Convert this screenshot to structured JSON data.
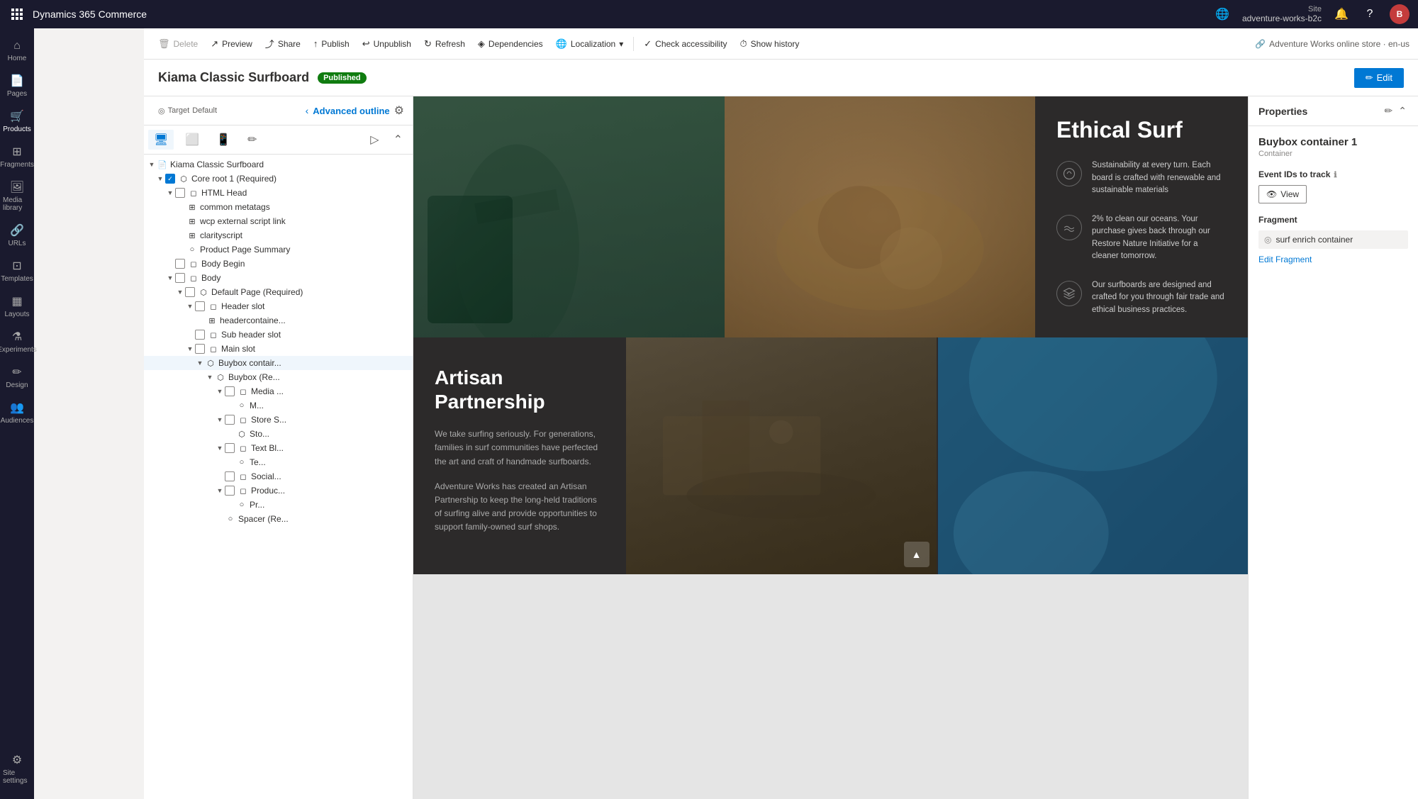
{
  "appBar": {
    "title": "Dynamics 365 Commerce",
    "site_label": "Site",
    "site_name": "adventure-works-b2c",
    "store_link": "Adventure Works online store · en-us"
  },
  "toolbar": {
    "delete_label": "Delete",
    "preview_label": "Preview",
    "share_label": "Share",
    "publish_label": "Publish",
    "unpublish_label": "Unpublish",
    "refresh_label": "Refresh",
    "dependencies_label": "Dependencies",
    "localization_label": "Localization",
    "check_accessibility_label": "Check accessibility",
    "show_history_label": "Show history"
  },
  "pageHeader": {
    "title": "Kiama Classic Surfboard",
    "status": "Published",
    "edit_label": "Edit",
    "target_label": "Target",
    "target_value": "Default"
  },
  "outline": {
    "title": "Advanced outline",
    "back_label": "‹",
    "tree": [
      {
        "id": 1,
        "label": "Kiama Classic Surfboard",
        "level": 0,
        "type": "page",
        "expanded": true,
        "hasChevron": true
      },
      {
        "id": 2,
        "label": "Core root 1 (Required)",
        "level": 1,
        "type": "container",
        "expanded": true,
        "hasChevron": true,
        "hasCheckbox": true
      },
      {
        "id": 3,
        "label": "HTML Head",
        "level": 2,
        "type": "module",
        "expanded": true,
        "hasChevron": true,
        "hasCheckbox": true
      },
      {
        "id": 4,
        "label": "common metatags",
        "level": 3,
        "type": "module",
        "hasCheckbox": false
      },
      {
        "id": 5,
        "label": "wcp external script link",
        "level": 3,
        "type": "module",
        "hasCheckbox": false
      },
      {
        "id": 6,
        "label": "clarityscript",
        "level": 3,
        "type": "module",
        "hasCheckbox": false
      },
      {
        "id": 7,
        "label": "Product Page Summary",
        "level": 3,
        "type": "circle",
        "hasCheckbox": false
      },
      {
        "id": 8,
        "label": "Body Begin",
        "level": 2,
        "type": "module",
        "hasCheckbox": true
      },
      {
        "id": 9,
        "label": "Body",
        "level": 2,
        "type": "module",
        "expanded": true,
        "hasChevron": true,
        "hasCheckbox": true
      },
      {
        "id": 10,
        "label": "Default Page (Required)",
        "level": 3,
        "type": "container",
        "expanded": true,
        "hasChevron": true,
        "hasCheckbox": true
      },
      {
        "id": 11,
        "label": "Header slot",
        "level": 4,
        "type": "module",
        "expanded": true,
        "hasChevron": true,
        "hasCheckbox": true
      },
      {
        "id": 12,
        "label": "headercontaine...",
        "level": 5,
        "type": "module",
        "hasCheckbox": false
      },
      {
        "id": 13,
        "label": "Sub header slot",
        "level": 4,
        "type": "module",
        "hasCheckbox": true
      },
      {
        "id": 14,
        "label": "Main slot",
        "level": 4,
        "type": "module",
        "expanded": true,
        "hasChevron": true,
        "hasCheckbox": true
      },
      {
        "id": 15,
        "label": "Buybox contair...",
        "level": 5,
        "type": "container",
        "expanded": true,
        "hasChevron": true,
        "selected": true
      },
      {
        "id": 16,
        "label": "Buybox (Re...",
        "level": 6,
        "type": "container",
        "expanded": true,
        "hasChevron": true
      },
      {
        "id": 17,
        "label": "Media ...",
        "level": 7,
        "type": "module",
        "expanded": true,
        "hasChevron": true,
        "hasCheckbox": true
      },
      {
        "id": 18,
        "label": "M...",
        "level": 8,
        "type": "circle"
      },
      {
        "id": 19,
        "label": "Store S...",
        "level": 7,
        "type": "module",
        "expanded": true,
        "hasChevron": true,
        "hasCheckbox": true
      },
      {
        "id": 20,
        "label": "Sto...",
        "level": 8,
        "type": "container"
      },
      {
        "id": 21,
        "label": "Text Bl...",
        "level": 7,
        "type": "module",
        "expanded": true,
        "hasChevron": true,
        "hasCheckbox": true
      },
      {
        "id": 22,
        "label": "Te...",
        "level": 8,
        "type": "circle"
      },
      {
        "id": 23,
        "label": "Social...",
        "level": 7,
        "type": "module",
        "hasCheckbox": true
      },
      {
        "id": 24,
        "label": "Produc...",
        "level": 7,
        "type": "module",
        "expanded": true,
        "hasChevron": true,
        "hasCheckbox": true
      },
      {
        "id": 25,
        "label": "Pr...",
        "level": 8,
        "type": "circle"
      },
      {
        "id": 26,
        "label": "Spacer (Re...",
        "level": 7,
        "type": "circle"
      }
    ]
  },
  "canvas": {
    "heroTitle": "Ethical Surf",
    "heroPoints": [
      "Sustainability at every turn. Each board is crafted with renewable and sustainable materials",
      "2% to clean our oceans. Your purchase gives back through our Restore Nature Initiative for a cleaner tomorrow.",
      "Our surfboards are designed and crafted for you through fair trade and ethical business practices."
    ],
    "artisanTitle": "Artisan Partnership",
    "artisanDesc1": "We take surfing seriously. For generations, families in surf communities have perfected the art and craft of handmade surfboards.",
    "artisanDesc2": "Adventure Works has created an Artisan Partnership to keep the long-held traditions of surfing alive and provide opportunities to support family-owned surf shops."
  },
  "properties": {
    "panel_title": "Properties",
    "component_name": "Buybox container 1",
    "component_type": "Container",
    "event_ids_label": "Event IDs to track",
    "view_btn_label": "View",
    "fragment_label": "Fragment",
    "fragment_name": "surf enrich container",
    "edit_fragment_label": "Edit Fragment"
  }
}
